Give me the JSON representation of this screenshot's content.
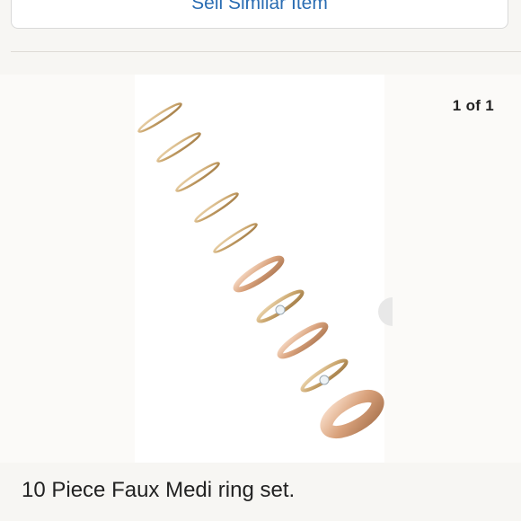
{
  "top_button": {
    "label": "Sell Similar Item"
  },
  "gallery": {
    "counter": "1 of 1"
  },
  "listing": {
    "title": "10 Piece Faux Medi ring set."
  },
  "colors": {
    "gold": "#c9a46b",
    "rose_gold": "#d9a27c",
    "link_blue": "#2a6db3"
  },
  "icons": {
    "next": "chevron-right-icon"
  }
}
